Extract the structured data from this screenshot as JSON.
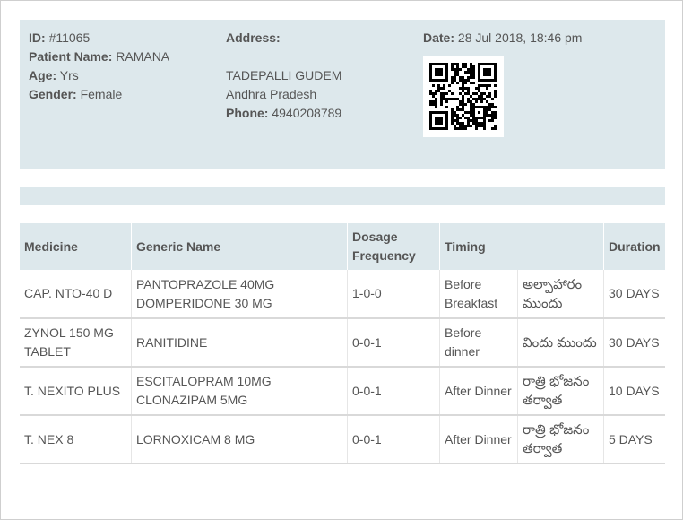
{
  "patient": {
    "id_label": "ID:",
    "id_value": "#11065",
    "name_label": "Patient Name:",
    "name_value": "RAMANA",
    "age_label": "Age:",
    "age_value": "Yrs",
    "gender_label": "Gender:",
    "gender_value": "Female"
  },
  "address": {
    "label": "Address:",
    "line1": "TADEPALLI GUDEM",
    "line2": "Andhra Pradesh",
    "phone_label": "Phone:",
    "phone_value": "4940208789"
  },
  "visit": {
    "date_label": "Date:",
    "date_value": "28 Jul 2018, 18:46 pm"
  },
  "table": {
    "headers": {
      "medicine": "Medicine",
      "generic": "Generic Name",
      "dosage_line1": "Dosage",
      "dosage_line2": "Frequency",
      "timing": "Timing",
      "duration": "Duration"
    },
    "rows": [
      {
        "medicine": [
          "CAP. NTO-40 D"
        ],
        "generic": [
          "PANTOPRAZOLE 40MG",
          "DOMPERIDONE 30 MG"
        ],
        "dosage": "1-0-0",
        "timing": [
          "Before",
          "Breakfast"
        ],
        "timing_telugu": [
          "అల్పాహారం",
          "ముందు"
        ],
        "duration": "30 DAYS"
      },
      {
        "medicine": [
          "ZYNOL 150 MG",
          "TABLET"
        ],
        "generic": [
          "RANITIDINE"
        ],
        "dosage": "0-0-1",
        "timing": [
          "Before",
          "dinner"
        ],
        "timing_telugu": [
          "విందు ముందు"
        ],
        "duration": "30 DAYS"
      },
      {
        "medicine": [
          "T. NEXITO PLUS"
        ],
        "generic": [
          "ESCITALOPRAM 10MG",
          "CLONAZIPAM 5MG"
        ],
        "dosage": "0-0-1",
        "timing": [
          "After Dinner"
        ],
        "timing_telugu": [
          "రాత్రి భోజనం",
          "తర్వాత"
        ],
        "duration": "10 DAYS"
      },
      {
        "medicine": [
          "T. NEX 8"
        ],
        "generic": [
          "LORNOXICAM 8 MG"
        ],
        "dosage": "0-0-1",
        "timing": [
          "After Dinner"
        ],
        "timing_telugu": [
          "రాత్రి భోజనం",
          "తర్వాత"
        ],
        "duration": "5 DAYS"
      }
    ]
  },
  "colors": {
    "panel_bg": "#dde8ec",
    "text": "#555555",
    "row_border": "#d9d9d9"
  }
}
